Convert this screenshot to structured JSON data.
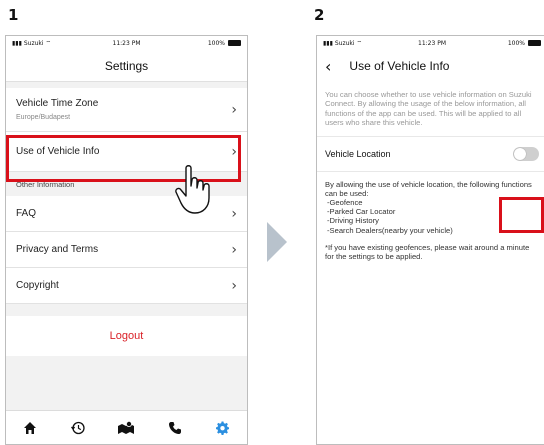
{
  "steps": {
    "step1": "1",
    "step2": "2"
  },
  "status_bar": {
    "carrier": "Suzuki",
    "time": "11:23 PM",
    "battery": "100%"
  },
  "screen1": {
    "title": "Settings",
    "items": [
      {
        "label": "Vehicle Time Zone",
        "sub": "Europe/Budapest"
      },
      {
        "label": "Use of Vehicle Info"
      }
    ],
    "section_label": "Other Information",
    "other_items": [
      {
        "label": "FAQ"
      },
      {
        "label": "Privacy and Terms"
      },
      {
        "label": "Copyright"
      }
    ],
    "logout": "Logout",
    "tabs": [
      "home-icon",
      "history-icon",
      "map-icon",
      "phone-icon",
      "settings-icon"
    ]
  },
  "screen2": {
    "title": "Use of Vehicle Info",
    "intro": "You can choose whether to use vehicle information on Suzuki Connect. By allowing the usage of the below information, all functions of the app can be used. This will be applied to all users who share this vehicle.",
    "toggle_label": "Vehicle Location",
    "toggle_state": "off",
    "desc": "By allowing the use of vehicle location, the following functions can be used:",
    "functions": [
      "-Geofence",
      "-Parked Car Locator",
      "-Driving History",
      "-Search Dealers(nearby your vehicle)"
    ],
    "note": "*If you have existing geofences, please wait around a minute for the settings to be applied."
  },
  "colors": {
    "highlight": "#d9101a",
    "accent_tab": "#2b8fe0",
    "logout": "#d91f26"
  }
}
